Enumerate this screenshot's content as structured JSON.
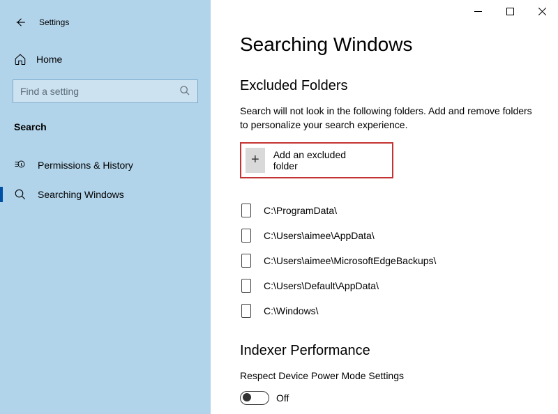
{
  "window": {
    "app_title": "Settings"
  },
  "sidebar": {
    "home": "Home",
    "search_placeholder": "Find a setting",
    "category": "Search",
    "items": [
      {
        "label": "Permissions & History"
      },
      {
        "label": "Searching Windows"
      }
    ]
  },
  "main": {
    "title": "Searching Windows",
    "section1": {
      "heading": "Excluded Folders",
      "description": "Search will not look in the following folders. Add and remove folders to personalize your search experience.",
      "add_label": "Add an excluded folder",
      "folders": [
        "C:\\ProgramData\\",
        "C:\\Users\\aimee\\AppData\\",
        "C:\\Users\\aimee\\MicrosoftEdgeBackups\\",
        "C:\\Users\\Default\\AppData\\",
        "C:\\Windows\\"
      ]
    },
    "section2": {
      "heading": "Indexer Performance",
      "setting_label": "Respect Device Power Mode Settings",
      "toggle_state": "Off"
    }
  }
}
